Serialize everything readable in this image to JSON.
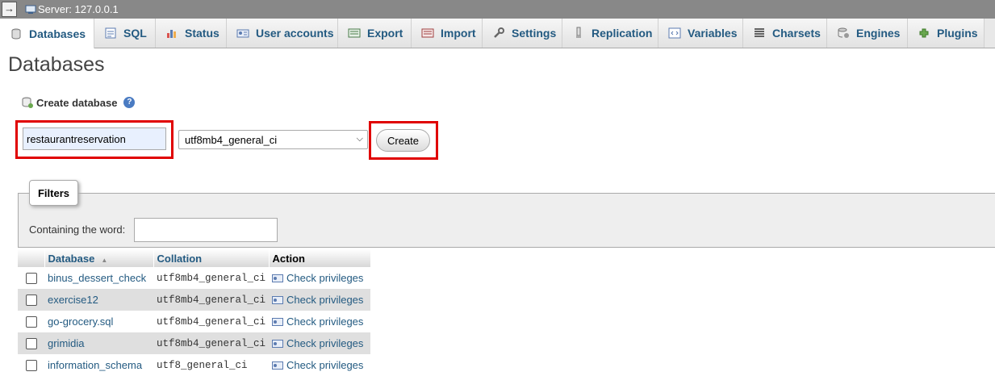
{
  "topbar": {
    "back_arrow": "→",
    "server_label": "Server: 127.0.0.1"
  },
  "tabs": [
    {
      "label": "Databases",
      "icon": "database-icon",
      "active": true
    },
    {
      "label": "SQL",
      "icon": "sql-icon"
    },
    {
      "label": "Status",
      "icon": "status-chart-icon"
    },
    {
      "label": "User accounts",
      "icon": "user-accounts-icon"
    },
    {
      "label": "Export",
      "icon": "export-icon"
    },
    {
      "label": "Import",
      "icon": "import-icon"
    },
    {
      "label": "Settings",
      "icon": "wrench-icon"
    },
    {
      "label": "Replication",
      "icon": "replication-icon"
    },
    {
      "label": "Variables",
      "icon": "variables-icon"
    },
    {
      "label": "Charsets",
      "icon": "charsets-icon"
    },
    {
      "label": "Engines",
      "icon": "engines-icon"
    },
    {
      "label": "Plugins",
      "icon": "plugin-icon"
    }
  ],
  "page_title": "Databases",
  "create": {
    "heading": "Create database",
    "db_name_value": "restaurantreservation",
    "collation_selected": "utf8mb4_general_ci",
    "button_label": "Create",
    "highlight_color": "#e00000"
  },
  "filters": {
    "legend": "Filters",
    "containing_label": "Containing the word:",
    "containing_value": ""
  },
  "table": {
    "headers": {
      "database": "Database",
      "collation": "Collation",
      "action": "Action"
    },
    "rows": [
      {
        "name": "binus_dessert_check",
        "collation": "utf8mb4_general_ci",
        "action": "Check privileges"
      },
      {
        "name": "exercise12",
        "collation": "utf8mb4_general_ci",
        "action": "Check privileges"
      },
      {
        "name": "go-grocery.sql",
        "collation": "utf8mb4_general_ci",
        "action": "Check privileges"
      },
      {
        "name": "grimidia",
        "collation": "utf8mb4_general_ci",
        "action": "Check privileges"
      },
      {
        "name": "information_schema",
        "collation": "utf8_general_ci",
        "action": "Check privileges"
      }
    ]
  },
  "colors": {
    "link": "#235a81",
    "topbar": "#888888"
  }
}
